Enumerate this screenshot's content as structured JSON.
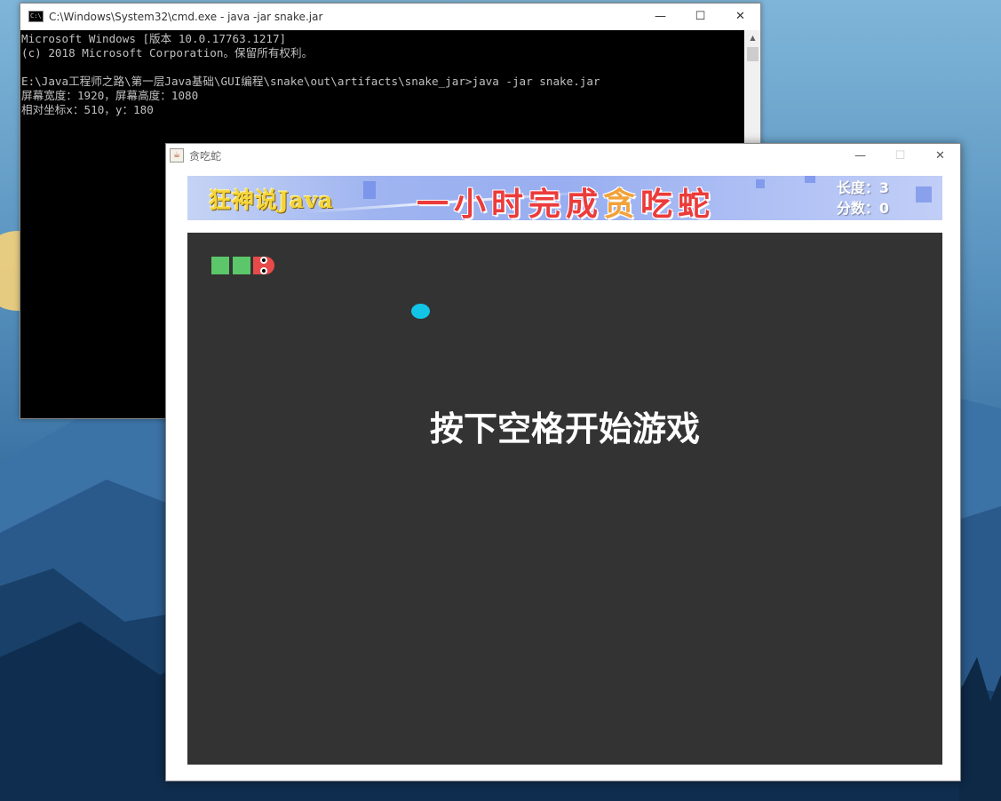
{
  "cmd": {
    "title": "C:\\Windows\\System32\\cmd.exe - java  -jar snake.jar",
    "lines": [
      "Microsoft Windows [版本 10.0.17763.1217]",
      "(c) 2018 Microsoft Corporation。保留所有权利。",
      "",
      "E:\\Java工程师之路\\第一层Java基础\\GUI编程\\snake\\out\\artifacts\\snake_jar>java -jar snake.jar",
      "屏幕宽度：1920，屏幕高度：1080",
      "相对坐标x：510，y：180"
    ]
  },
  "game_window": {
    "title": "贪吃蛇",
    "banner": {
      "left_text": "狂神说Java",
      "mid_text_a": "一小时完成",
      "mid_text_b": "贪",
      "mid_text_c": "吃蛇",
      "length_label": "长度：3",
      "score_label": "分数：0"
    },
    "prompt": "按下空格开始游戏",
    "colors": {
      "board": "#333333",
      "snake_body": "#5cc66a",
      "snake_head": "#e84a4a",
      "food": "#12c5e6"
    }
  },
  "window_controls": {
    "minimize": "—",
    "maximize": "☐",
    "close": "✕"
  }
}
